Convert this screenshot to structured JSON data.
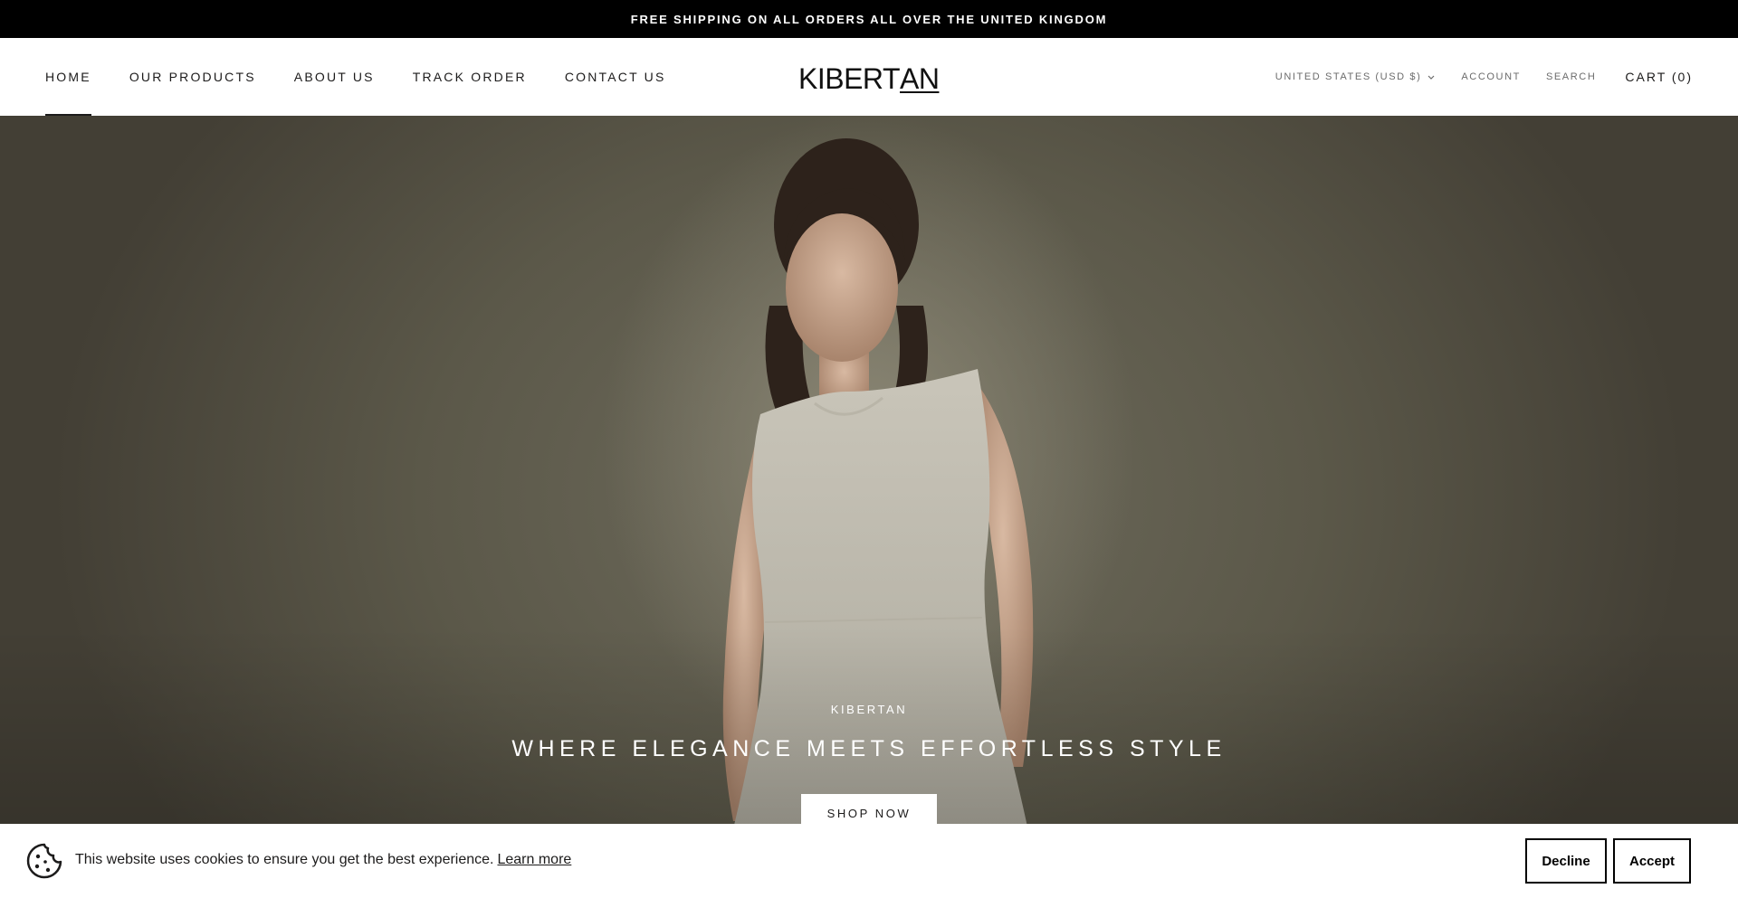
{
  "announcement": {
    "text": "FREE SHIPPING ON ALL ORDERS ALL OVER THE UNITED KINGDOM"
  },
  "header": {
    "nav": [
      {
        "label": "HOME",
        "active": true
      },
      {
        "label": "OUR PRODUCTS",
        "active": false
      },
      {
        "label": "ABOUT US",
        "active": false
      },
      {
        "label": "TRACK ORDER",
        "active": false
      },
      {
        "label": "CONTACT US",
        "active": false
      }
    ],
    "logo": {
      "part1": "KIBERT",
      "part2": "AN"
    },
    "currency": "UNITED STATES (USD $)",
    "account": "ACCOUNT",
    "search": "SEARCH",
    "cart": "CART (0)"
  },
  "hero": {
    "subheading": "KIBERTAN",
    "title": "WHERE ELEGANCE MEETS EFFORTLESS STYLE",
    "button": "SHOP NOW"
  },
  "cookie_banner": {
    "message": "This website uses cookies to ensure you get the best experience.",
    "learn_more": "Learn more",
    "decline": "Decline",
    "accept": "Accept"
  },
  "colors": {
    "announcement_bg": "#000000",
    "text": "#1c1b1b",
    "hero_bg": "#5b5849"
  },
  "icons": [
    "chevron-down-icon",
    "cookie-icon"
  ]
}
